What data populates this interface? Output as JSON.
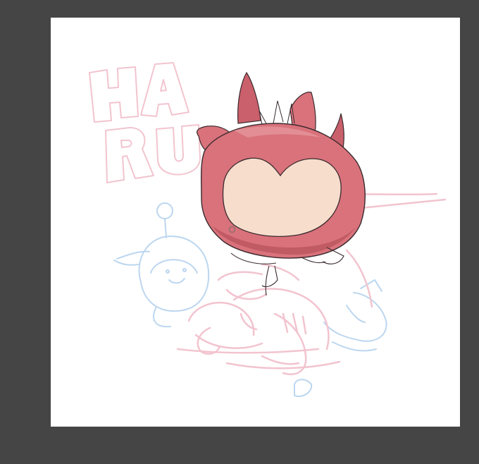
{
  "app": {
    "workspace_color": "#454545",
    "canvas_color": "#ffffff"
  },
  "artwork": {
    "lettering": "HARU",
    "sketch_colors": {
      "pink_lines": "#f2c4cf",
      "blue_lines": "#bcd6f0",
      "hood_fill": "#d9727b",
      "hood_dark": "#b9545e",
      "face_fill": "#f7ddcc",
      "outline": "#3a2a2e"
    }
  },
  "cursor": {
    "icon": "brush-cursor-circle"
  }
}
